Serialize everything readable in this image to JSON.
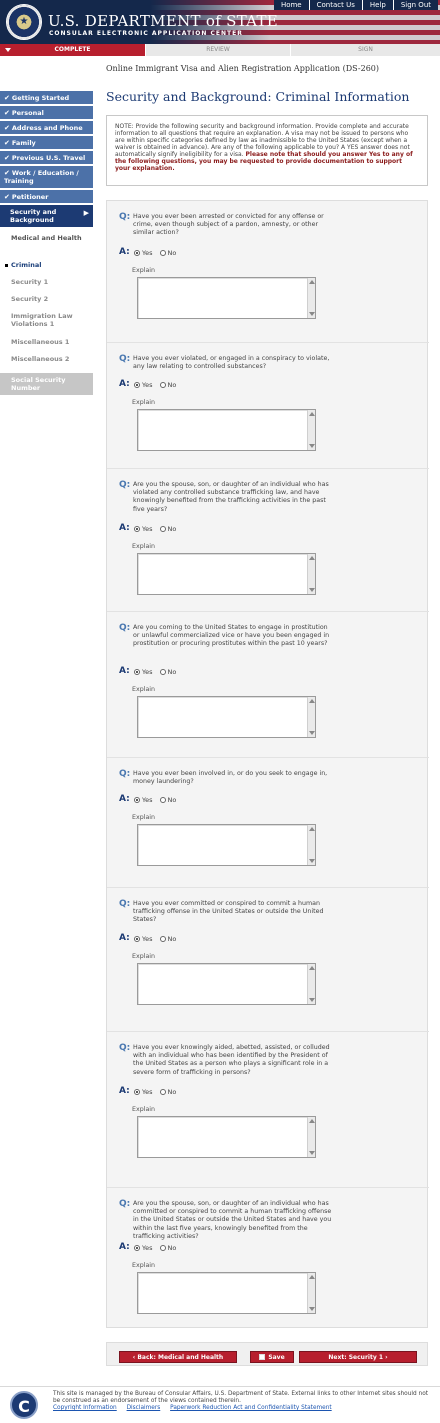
{
  "header": {
    "title": "U.S. DEPARTMENT of STATE",
    "subtitle": "CONSULAR ELECTRONIC APPLICATION CENTER",
    "nav": [
      "Home",
      "Contact Us",
      "Help",
      "Sign Out"
    ]
  },
  "progress": {
    "complete": "COMPLETE",
    "review": "REVIEW",
    "sign": "SIGN"
  },
  "sidebar": {
    "done": [
      "Getting Started",
      "Personal",
      "Address and Phone",
      "Family",
      "Previous U.S. Travel",
      "Work / Education / Training",
      "Petitioner"
    ],
    "current": "Security and Background",
    "sub": [
      {
        "label": "Medical and Health",
        "state": "done"
      },
      {
        "label": "Criminal",
        "state": "active"
      },
      {
        "label": "Security 1",
        "state": "pending"
      },
      {
        "label": "Security 2",
        "state": "pending"
      },
      {
        "label": "Immigration Law Violations 1",
        "state": "pending"
      },
      {
        "label": "Miscellaneous 1",
        "state": "pending"
      },
      {
        "label": "Miscellaneous 2",
        "state": "pending"
      },
      {
        "label": "Social Security Number",
        "state": "disabled"
      }
    ]
  },
  "main": {
    "app_title": "Online Immigrant Visa and Alien Registration Application (DS-260)",
    "page_title": "Security and Background: Criminal Information",
    "note_plain": "NOTE: Provide the following security and background information. Provide complete and accurate information to all questions that require an explanation. A visa may not be issued to persons who are within specific categories defined by law as inadmissible to the United States (except when a waiver is obtained in advance). Are any of the following applicable to you? A YES answer does not automatically signify ineligibility for a visa.",
    "note_bold": "Please note that should you answer Yes to any of the following questions, you may be requested to provide documentation to support your explanation.",
    "q_label": "Q:",
    "a_label": "A:",
    "yes_label": "Yes",
    "no_label": "No",
    "explain_label": "Explain",
    "questions": [
      {
        "text": "Have you ever been arrested or convicted for any offense or crime, even though subject of a pardon, amnesty, or other similar action?",
        "answer": "Yes"
      },
      {
        "text": "Have you ever violated, or engaged in a conspiracy to violate, any law relating to controlled substances?",
        "answer": "Yes"
      },
      {
        "text": "Are you the spouse, son, or daughter of an individual who has violated any controlled substance trafficking law, and have knowingly benefited from the trafficking activities in the past five years?",
        "answer": "Yes"
      },
      {
        "text": "Are you coming to the United States to engage in prostitution or unlawful commercialized vice or have you been engaged in prostitution or procuring prostitutes within the past 10 years?",
        "answer": "Yes"
      },
      {
        "text": "Have you ever been involved in, or do you seek to engage in, money laundering?",
        "answer": "Yes"
      },
      {
        "text": "Have you ever committed or conspired to commit a human trafficking offense in the United States or outside the United States?",
        "answer": "Yes"
      },
      {
        "text": "Have you ever knowingly aided, abetted, assisted, or colluded with an individual who has been identified by the President of the United States as a person who plays a significant role in a severe form of trafficking in persons?",
        "answer": "Yes"
      },
      {
        "text": "Are you the spouse, son, or daughter of an individual who has committed or conspired to commit a human trafficking offense in the United States or outside the United States and have you within the last five years, knowingly benefited from the trafficking activities?",
        "answer": "Yes"
      }
    ]
  },
  "buttons": {
    "back": "Back: Medical and Health",
    "save": "Save",
    "next": "Next: Security 1"
  },
  "footer": {
    "text": "This site is managed by the Bureau of Consular Affairs, U.S. Department of State. External links to other Internet sites should not be construed as an endorsement of the views contained therein.",
    "links": [
      "Copyright Information",
      "Disclaimers",
      "Paperwork Reduction Act and Confidentiality Statement"
    ]
  }
}
